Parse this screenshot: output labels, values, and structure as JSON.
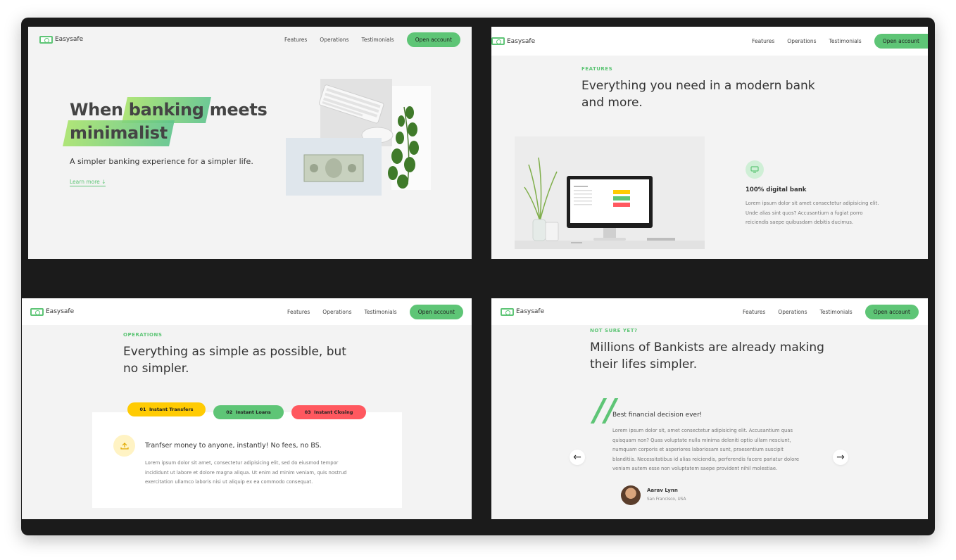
{
  "brand": {
    "name": "Easysafe",
    "accent": "#5ec576"
  },
  "nav": {
    "links": [
      "Features",
      "Operations",
      "Testimonials"
    ],
    "cta": "Open account"
  },
  "hero": {
    "title_pre": "When",
    "title_hl1": "banking",
    "title_mid": "meets",
    "title_hl2": "minimalist",
    "subtitle": "A simpler banking experience for a simpler life.",
    "learn_more": "Learn more ↓"
  },
  "features": {
    "kicker": "FEATURES",
    "title_line1": "Everything you need in a modern bank",
    "title_line2": "and more.",
    "item_icon": "monitor-icon",
    "item_title": "100% digital bank",
    "item_text_1": "Lorem ipsum dolor sit amet consectetur adipisicing elit.",
    "item_text_2": "Unde alias sint quos? Accusantium a fugiat porro",
    "item_text_3": "reiciendis saepe quibusdam debitis ducimus."
  },
  "operations": {
    "kicker": "OPERATIONS",
    "title_line1": "Everything as simple as possible, but",
    "title_line2": "no simpler.",
    "tabs": [
      {
        "num": "01",
        "label": "Instant Transfers",
        "color": "#ffcb03"
      },
      {
        "num": "02",
        "label": "Instant Loans",
        "color": "#5ec576"
      },
      {
        "num": "03",
        "label": "Instant Closing",
        "color": "#ff585f"
      }
    ],
    "content_icon": "upload-icon",
    "content_title": "Tranfser money to anyone, instantly! No fees, no BS.",
    "content_text_1": "Lorem ipsum dolor sit amet, consectetur adipisicing elit, sed do eiusmod tempor",
    "content_text_2": "incididunt ut labore et dolore magna aliqua. Ut enim ad minim veniam, quis nostrud",
    "content_text_3": "exercitation ullamco laboris nisi ut aliquip ex ea commodo consequat."
  },
  "testimonials": {
    "kicker": "NOT SURE YET?",
    "title_line1": "Millions of Bankists are already making",
    "title_line2": "their lifes simpler.",
    "quote_title": "Best financial decision ever!",
    "quote_lines": [
      "Lorem ipsum dolor sit, amet consectetur adipisicing elit. Accusantium quas",
      "quisquam non? Quas voluptate nulla minima deleniti optio ullam nesciunt,",
      "numquam corporis et asperiores laboriosam sunt, praesentium suscipit",
      "blanditiis. Necessitatibus id alias reiciendis, perferendis facere pariatur dolore",
      "veniam autem esse non voluptatem saepe provident nihil molestiae."
    ],
    "author_name": "Aarav Lynn",
    "author_location": "San Francisco, USA",
    "prev": "←",
    "next": "→"
  }
}
